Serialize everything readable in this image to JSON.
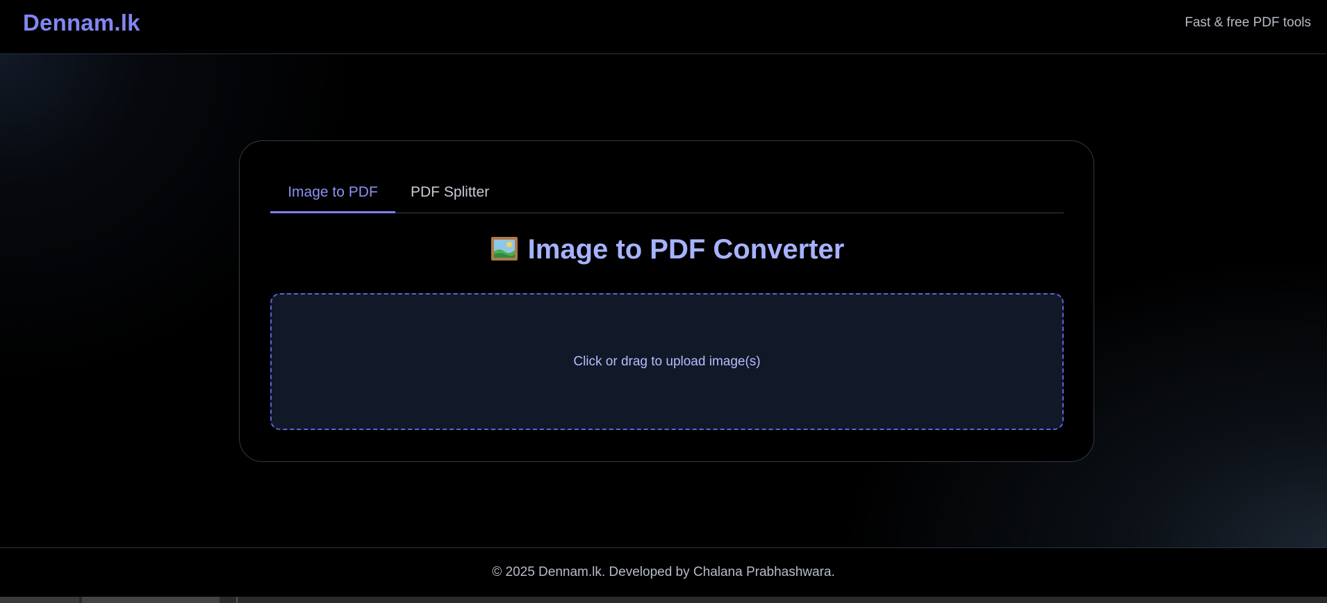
{
  "header": {
    "brand": "Dennam.lk",
    "tagline": "Fast & free PDF tools"
  },
  "tabs": [
    {
      "label": "Image to PDF",
      "active": true
    },
    {
      "label": "PDF Splitter",
      "active": false
    }
  ],
  "converter": {
    "title": "Image to PDF Converter",
    "title_icon": "framed-picture-icon",
    "dropzone_label": "Click or drag to upload image(s)"
  },
  "footer": {
    "text": "© 2025 Dennam.lk. Developed by Chalana Prabhashwara."
  },
  "colors": {
    "accent": "#8187f1",
    "title": "#a7b2ff",
    "dropzone_border": "#5e63d9",
    "dropzone_bg": "#111827",
    "background": "#000000"
  }
}
